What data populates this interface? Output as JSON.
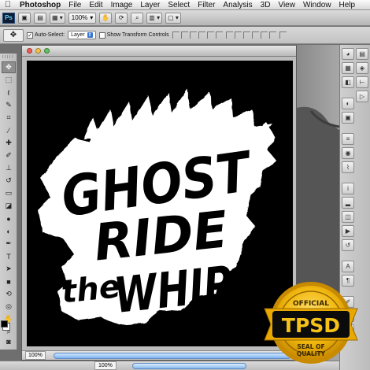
{
  "menubar": {
    "app_name": "Photoshop",
    "items": [
      "File",
      "Edit",
      "Image",
      "Layer",
      "Select",
      "Filter",
      "Analysis",
      "3D",
      "View",
      "Window",
      "Help"
    ]
  },
  "appbar": {
    "logo": "Ps",
    "zoom": "100%"
  },
  "options": {
    "auto_select_label": "Auto-Select:",
    "auto_select_checked": true,
    "auto_select_target": "Layer",
    "show_transform_label": "Show Transform Controls",
    "show_transform_checked": false
  },
  "document": {
    "artwork_lines": [
      "GHOST",
      "RIDE",
      "the",
      "WHIP"
    ],
    "status_zoom": "100%"
  },
  "bottom": {
    "zoom": "100%"
  },
  "seal": {
    "top_text": "OFFICIAL",
    "brand": "TPSD",
    "bottom_line1": "SEAL OF",
    "bottom_line2": "QUALITY"
  },
  "colors": {
    "accent_blue": "#3a75d6",
    "seal_gold": "#f2b90f",
    "canvas_bg": "#000000"
  },
  "icons": {
    "toolbox": [
      "move-icon",
      "marquee-icon",
      "lasso-icon",
      "quick-select-icon",
      "crop-icon",
      "eyedropper-icon",
      "healing-icon",
      "brush-icon",
      "stamp-icon",
      "history-brush-icon",
      "eraser-icon",
      "paint-bucket-icon",
      "blur-icon",
      "dodge-icon",
      "pen-icon",
      "type-icon",
      "path-select-icon",
      "shape-icon",
      "3d-rotate-icon",
      "3d-orbit-icon",
      "hand-icon",
      "zoom-icon"
    ],
    "right_panel": [
      "color-icon",
      "swatches-icon",
      "styles-icon",
      "adjustments-icon",
      "masks-icon",
      "layers-icon",
      "channels-icon",
      "paths-icon",
      "info-icon",
      "histogram-icon",
      "navigator-icon",
      "actions-icon",
      "history-icon",
      "character-icon",
      "paragraph-icon",
      "brushes-icon",
      "clone-source-icon",
      "tool-presets-icon",
      "notes-icon",
      "3d-icon",
      "measurement-icon",
      "animation-icon"
    ]
  }
}
